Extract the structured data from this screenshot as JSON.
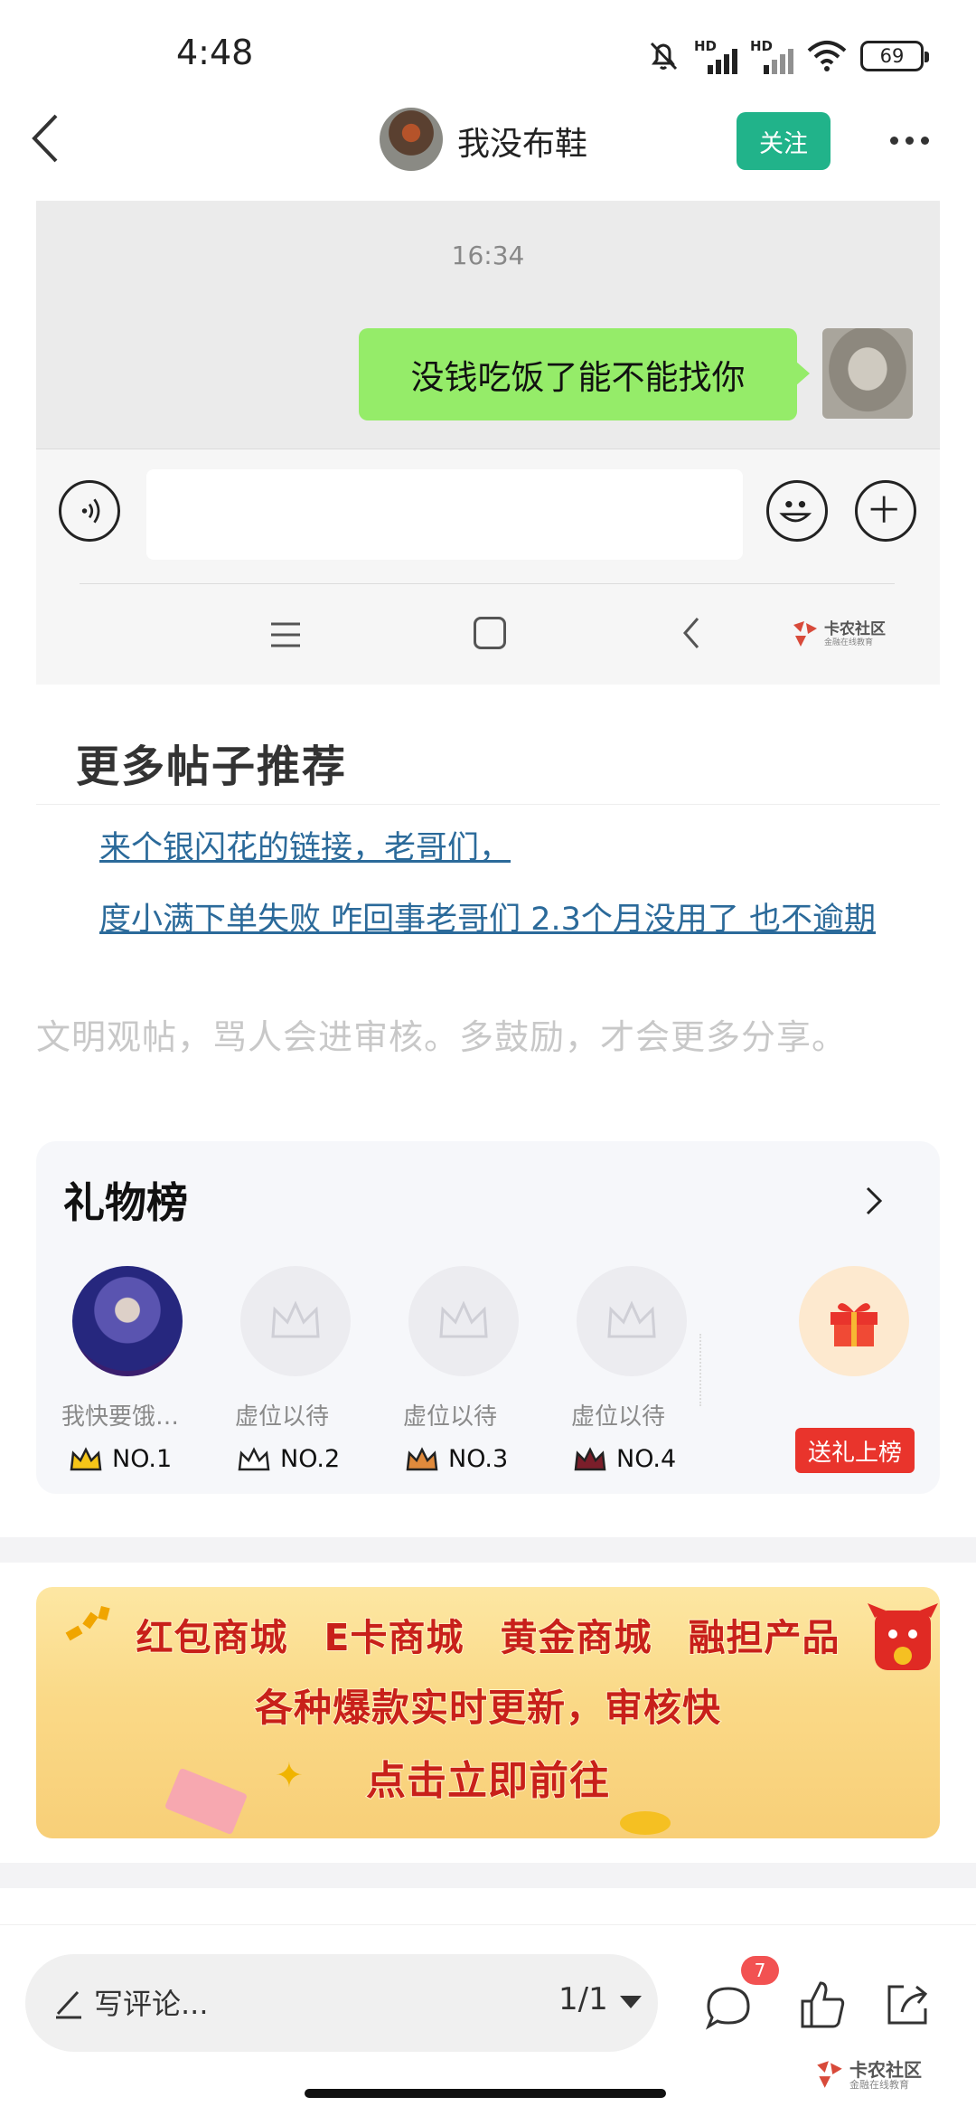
{
  "status_bar": {
    "time": "4:48",
    "signal1_label": "HD",
    "signal2_label": "HD",
    "battery": "69"
  },
  "nav": {
    "username": "我没布鞋",
    "follow_label": "关注"
  },
  "chat_screenshot": {
    "time": "16:34",
    "message": "没钱吃饭了能不能找你",
    "watermark_name": "卡农社区",
    "watermark_sub": "金融在线教育"
  },
  "more_posts": {
    "title": "更多帖子推荐",
    "links": [
      "来个银闪花的链接，老哥们，",
      "度小满下单失败 咋回事老哥们 2.3个月没用了 也不逾期"
    ]
  },
  "civility_note": "文明观帖，骂人会进审核。多鼓励，才会更多分享。",
  "gift_ranking": {
    "title": "礼物榜",
    "slots": [
      {
        "name": "我快要饿死了",
        "rank": "NO.1"
      },
      {
        "name": "虚位以待",
        "rank": "NO.2"
      },
      {
        "name": "虚位以待",
        "rank": "NO.3"
      },
      {
        "name": "虚位以待",
        "rank": "NO.4"
      }
    ],
    "send_gift_label": "送礼上榜",
    "colors": {
      "no1": "#f5c518",
      "no2": "#ffffff",
      "no3": "#e08a3c",
      "no4": "#7a1e2a"
    }
  },
  "banner": {
    "line1": [
      "红包商城",
      "E卡商城",
      "黄金商城",
      "融担产品"
    ],
    "line2": "各种爆款实时更新，审核快",
    "line3": "点击立即前往"
  },
  "bottom_bar": {
    "comment_placeholder": "写评论...",
    "page_indicator": "1/1",
    "comment_count": "7",
    "watermark_name": "卡农社区",
    "watermark_sub": "金融在线教育"
  },
  "accent_colors": {
    "follow": "#21b38a",
    "chat_bubble": "#95ec69",
    "link": "#2b6a9a",
    "badge": "#f25252",
    "send_gift": "#e9342c"
  }
}
